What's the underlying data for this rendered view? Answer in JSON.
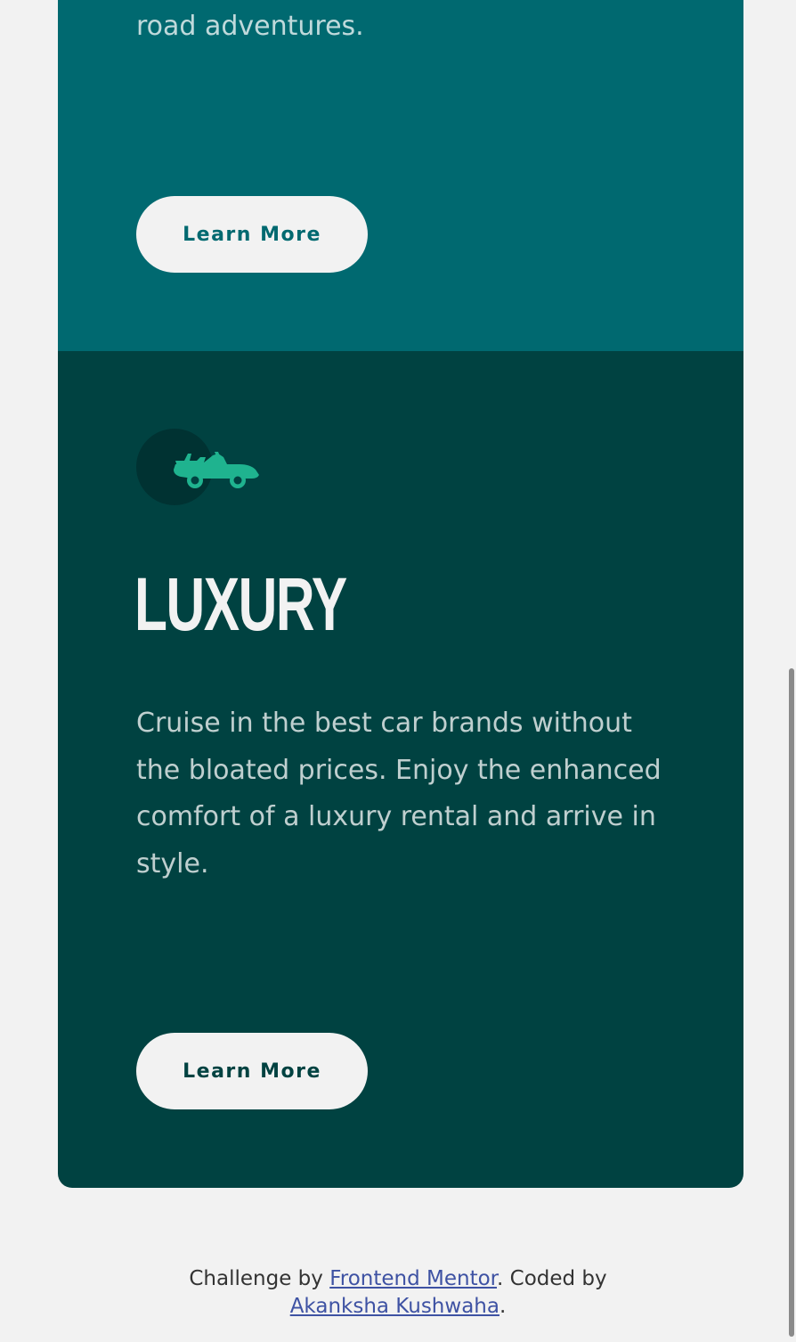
{
  "cards": {
    "suv": {
      "description_tail": "road adventures.",
      "button_label": "Learn More",
      "bg_color": "#006970"
    },
    "luxury": {
      "icon": "car-icon",
      "title": "LUXURY",
      "description": "Cruise in the best car brands without the bloated prices. Enjoy the enhanced comfort of a luxury rental and arrive in style.",
      "button_label": "Learn More",
      "bg_color": "#004241"
    }
  },
  "attribution": {
    "prefix": "Challenge by",
    "link1_label": "Frontend Mentor",
    "middle": ". Coded by",
    "link2_label": "Akanksha Kushwaha",
    "suffix": "."
  },
  "colors": {
    "page_bg": "#f2f2f2",
    "icon_accent": "#1fb38f",
    "link": "#3e52a3"
  }
}
